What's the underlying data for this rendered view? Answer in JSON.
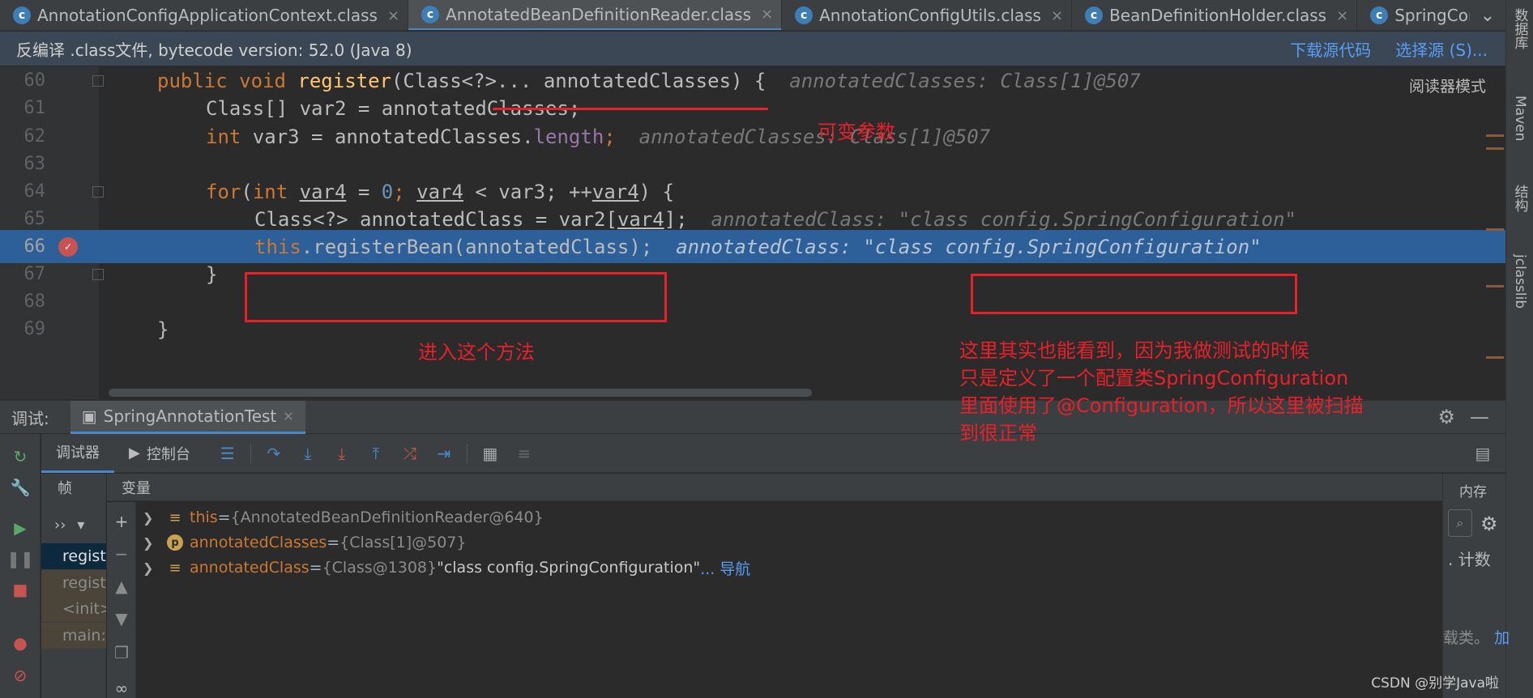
{
  "tabs": [
    {
      "label": "AnnotationConfigApplicationContext.class",
      "active": false
    },
    {
      "label": "AnnotatedBeanDefinitionReader.class",
      "active": true
    },
    {
      "label": "AnnotationConfigUtils.class",
      "active": false
    },
    {
      "label": "BeanDefinitionHolder.class",
      "active": false
    },
    {
      "label": "SpringConfiguration.ja",
      "active": false
    }
  ],
  "tab_icon_letter": "c",
  "tab_close_glyph": "×",
  "tab_overflow_glyph": "⌄",
  "banner": {
    "text": "反编译 .class文件, bytecode version: 52.0 (Java 8)",
    "download_link": "下载源代码",
    "choose_link": "选择源 (S)..."
  },
  "editor": {
    "reader_mode": "阅读器模式",
    "line_numbers": [
      "60",
      "61",
      "62",
      "63",
      "64",
      "65",
      "66",
      "67",
      "68",
      "69"
    ],
    "current_line": "66",
    "l60": {
      "kw": "public void ",
      "fn": "register",
      "rest": "(Class<?>... annotatedClasses) {",
      "hint": "annotatedClasses: Class[1]@507"
    },
    "l61": {
      "code": "Class[] var2 = annotatedClasses;"
    },
    "l62": {
      "kw": "int ",
      "mid": "var3 = annotatedClasses.",
      "fld": "length",
      "semi": ";",
      "hint": "annotatedClasses: Class[1]@507"
    },
    "l64": {
      "kw1": "for",
      "p1": "(",
      "kw2": "int ",
      "v1": "var4",
      "p2": " = ",
      "n0": "0",
      "p3": "; ",
      "v2": "var4",
      "p4": " < var3; ++",
      "v3": "var4",
      "p5": ") {"
    },
    "l65": {
      "pre": "Class<?> annotatedClass = var2[",
      "v": "var4",
      "post": "];",
      "hint": "annotatedClass: \"class config.SpringConfiguration\""
    },
    "l66": {
      "kw": "this",
      "rest": ".registerBean(annotatedClass);",
      "hint": "annotatedClass: \"class config.SpringConfiguration\""
    },
    "l67": {
      "code": "}"
    },
    "l69": {
      "code": "}"
    }
  },
  "right_stripe": [
    "数据库",
    "Maven",
    "结构",
    "jclasslib"
  ],
  "debug": {
    "title": "调试:",
    "run_tab": "SpringAnnotationTest",
    "subtabs": [
      "调试器",
      "控制台"
    ],
    "frames_label": "帧",
    "frames_ctrl": "››",
    "frames": [
      "regist",
      "regist",
      "<init>",
      "main:"
    ],
    "vars_label": "变量",
    "variables": [
      {
        "name": "this",
        "eq": " = ",
        "type": "{AnnotatedBeanDefinitionReader@640}",
        "value": "",
        "nav": "",
        "icon": "field"
      },
      {
        "name": "annotatedClasses",
        "eq": " = ",
        "type": "{Class[1]@507}",
        "value": "",
        "nav": "",
        "icon": "param"
      },
      {
        "name": "annotatedClass",
        "eq": " = ",
        "type": "{Class@1308}",
        "value": " \"class config.SpringConfiguration\"",
        "nav": " ... 导航",
        "icon": "field"
      }
    ],
    "memory_title": "内存",
    "memory_count": ". 计数",
    "memory_hint": "载类。",
    "memory_hint_link": "加"
  },
  "annotations": {
    "varargs": "可变参数",
    "enter_method": "进入这个方法",
    "explanation": [
      "这里其实也能看到，因为我做测试的时候",
      "只是定义了一个配置类SpringConfiguration",
      "里面使用了@Configuration，所以这里被扫描",
      "到很正常"
    ]
  },
  "watermark": "CSDN @别学Java啦",
  "colors": {
    "background": "#2b2b2b",
    "current_line": "#2d6099",
    "keyword": "#cc7832",
    "method": "#ffc66d",
    "field": "#9876aa",
    "number": "#6897bb",
    "annotation_red": "#e8202a",
    "link": "#589df6"
  }
}
